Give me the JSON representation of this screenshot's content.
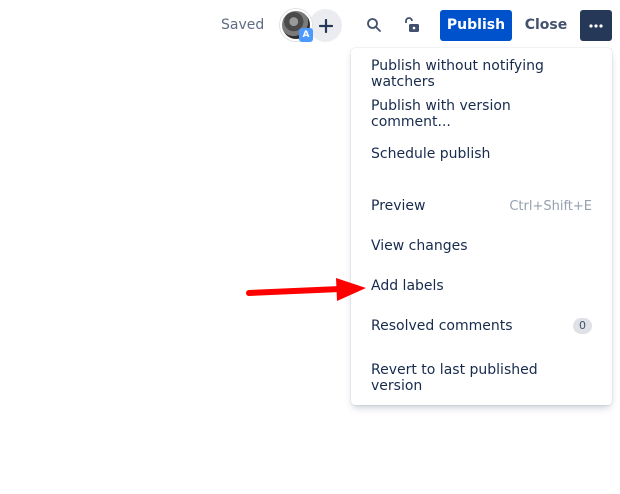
{
  "topbar": {
    "saved_label": "Saved",
    "avatar_badge": "A",
    "publish_label": "Publish",
    "close_label": "Close",
    "icons": {
      "add": "plus-icon",
      "search": "search-icon",
      "restrictions": "unlock-icon",
      "more": "more-horizontal-icon"
    }
  },
  "menu": {
    "items": [
      {
        "label": "Publish without notifying watchers"
      },
      {
        "label": "Publish with version comment..."
      },
      {
        "label": "Schedule publish"
      },
      {
        "label": "Preview",
        "shortcut": "Ctrl+Shift+E"
      },
      {
        "label": "View changes"
      },
      {
        "label": "Add labels"
      },
      {
        "label": "Resolved comments",
        "count": "0"
      },
      {
        "label": "Revert to last published version"
      }
    ]
  },
  "annotation": {
    "type": "arrow",
    "color": "#ff0000",
    "points_to": "Add labels"
  },
  "colors": {
    "primary": "#0052cc",
    "more_button": "#253858",
    "text": "#172b4d",
    "muted": "#5e6c84"
  }
}
